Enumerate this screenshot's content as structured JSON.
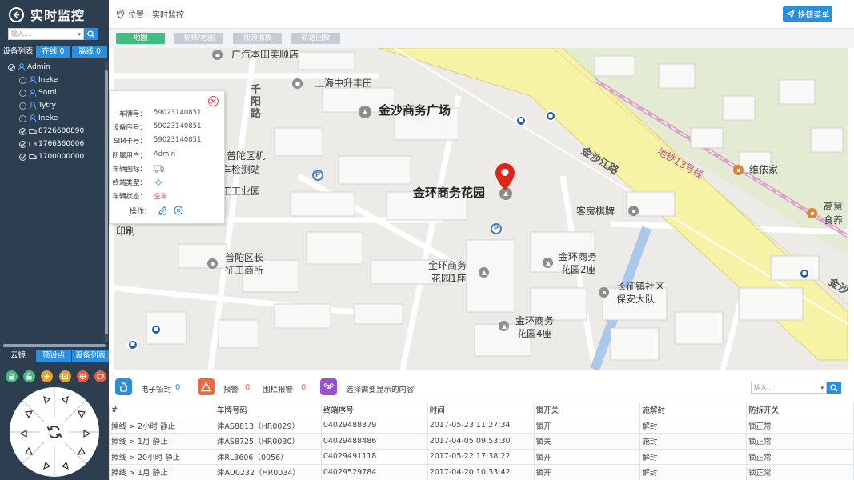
{
  "sidebar": {
    "title": "实时监控",
    "search_placeholder": "输入...",
    "tabs": {
      "list": "设备列表",
      "online": "在线 0",
      "offline": "离线 0"
    },
    "tree": [
      {
        "label": "Admin",
        "type": "user",
        "checked": true,
        "indent": 0
      },
      {
        "label": "Ineke",
        "type": "user",
        "checked": false,
        "indent": 1
      },
      {
        "label": "Somi",
        "type": "user",
        "checked": false,
        "indent": 1
      },
      {
        "label": "Tytry",
        "type": "user",
        "checked": false,
        "indent": 1
      },
      {
        "label": "Ineke",
        "type": "user",
        "checked": false,
        "indent": 1
      },
      {
        "label": "8726600890",
        "type": "device",
        "checked": true,
        "indent": 1
      },
      {
        "label": "1766360006",
        "type": "device",
        "checked": true,
        "indent": 1
      },
      {
        "label": "1700000000",
        "type": "device",
        "checked": true,
        "indent": 1
      }
    ],
    "ptz_tabs": {
      "cloud": "云镜",
      "preset": "预设点",
      "devices": "设备列表"
    },
    "ptz_icons": [
      {
        "name": "lock-icon",
        "color": "#3fbe7d"
      },
      {
        "name": "unlock-icon",
        "color": "#3fbe7d"
      },
      {
        "name": "add-icon",
        "color": "#f0a020"
      },
      {
        "name": "minus-icon",
        "color": "#f0a020"
      },
      {
        "name": "target-icon",
        "color": "#ef5a3c"
      },
      {
        "name": "vehicle-icon",
        "color": "#ef5a3c"
      }
    ]
  },
  "topbar": {
    "location": "位置：实时监控",
    "quick_menu": "快捷菜单"
  },
  "modes": [
    {
      "label": "地图",
      "active": true
    },
    {
      "label": "视频/地图",
      "active": false
    },
    {
      "label": "视频播放",
      "active": false
    },
    {
      "label": "轨迹回放",
      "active": false
    }
  ],
  "map": {
    "labels": {
      "honda": "广汽本田美顺店",
      "fengtian": "上海中升丰田",
      "plaza": "金沙商务广场",
      "road_qianyang": "千阳路",
      "putuo_jiguan": "普陀区机",
      "jianceshi": "车检测站",
      "gongye": "工工业园",
      "jinhuan": "金环商务花园",
      "kefang": "客房棋牌",
      "road_jinsha": "金沙江路",
      "metro": "地铁13号线",
      "weiyi": "维依家",
      "gaohui1": "高慧",
      "gaohui2": "食养",
      "yinshua": "印刷",
      "putuo_zhang1": "普陀区长",
      "putuo_zhang2": "征工商所",
      "jinhuan1_1": "金环商务",
      "jinhuan1_2": "花园1座",
      "jinhuan2_1": "金环商务",
      "jinhuan2_2": "花园2座",
      "changzheng1": "长征镇社区",
      "changzheng2": "保安大队",
      "jinhuan4_1": "金环商务",
      "jinhuan4_2": "花园4座",
      "jinsha_edge": "金沙"
    }
  },
  "popup": {
    "rows": [
      {
        "key": "车牌号：",
        "value": "59023140851"
      },
      {
        "key": "设备序号：",
        "value": "59023140851"
      },
      {
        "key": "SIM卡号：",
        "value": "59023140851"
      },
      {
        "key": "所属用户：",
        "value": "Admin"
      },
      {
        "key": "车辆图标：",
        "value": ""
      },
      {
        "key": "终端类型：",
        "value": ""
      },
      {
        "key": "车辆状态：",
        "value": "空车"
      }
    ],
    "ops_label": "操作："
  },
  "alarmbar": {
    "seal_label": "电子铅封",
    "seal_count": "0",
    "alarm_label": "报警",
    "alarm_count": "0",
    "fence_label": "围栏报警",
    "fence_count": "0",
    "select_label": "选择需要显示的内容",
    "search_placeholder": "输入..."
  },
  "table": {
    "headers": [
      "#",
      "车牌号码",
      "终端序号",
      "时间",
      "锁开关",
      "施解封",
      "防拆开关"
    ],
    "rows": [
      [
        "掉线 > 2小时 静止",
        "津AS8813（HR0029）",
        "04029488379",
        "2017-05-23 11:27:34",
        "锁开",
        "解封",
        "锁正常"
      ],
      [
        "掉线 > 1月 静止",
        "津AS8725（HR0030）",
        "04029488486",
        "2017-04-05 09:53:30",
        "锁关",
        "施封",
        "锁正常"
      ],
      [
        "掉线 > 20小时 静止",
        "津RL3606（0056）",
        "04029491118",
        "2017-05-22 17:38:22",
        "锁开",
        "解封",
        "锁正常"
      ],
      [
        "掉线 > 1月 静止",
        "津AU0232（HR0034）",
        "04029529784",
        "2017-04-20 10:33:42",
        "锁开",
        "解封",
        "锁正常"
      ]
    ]
  }
}
